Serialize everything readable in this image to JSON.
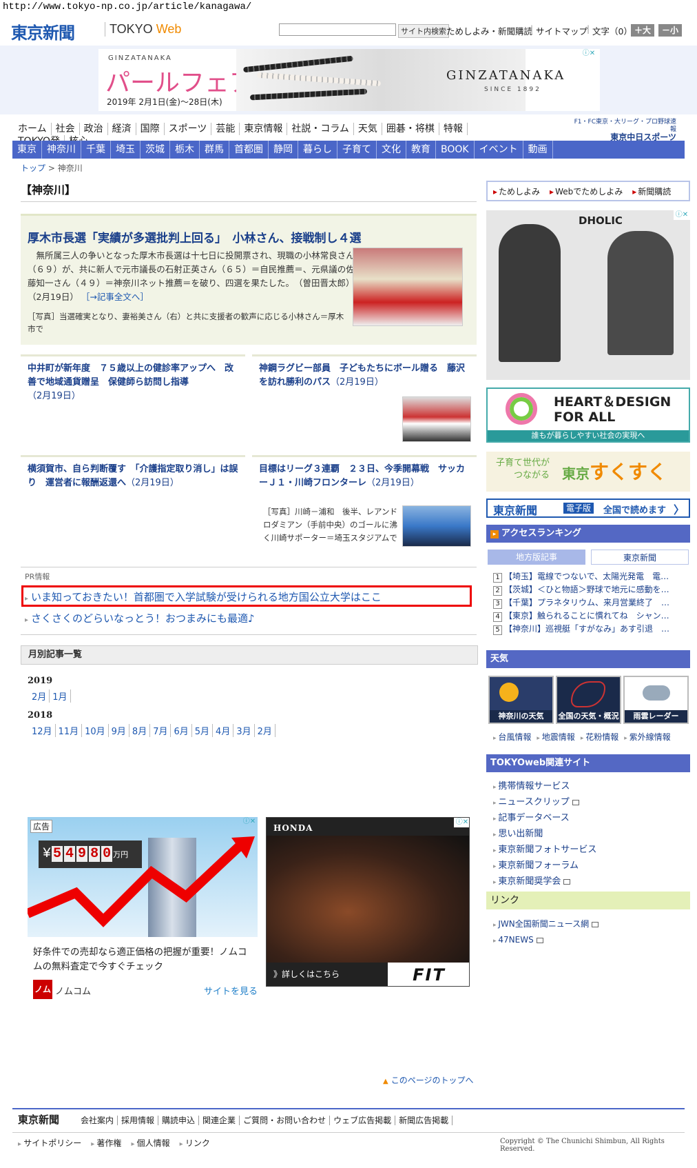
{
  "url": "http://www.tokyo-np.co.jp/article/kanagawa/",
  "header": {
    "logo": "東京新聞",
    "logo_web_prefix": "TOKYO",
    "logo_web_suffix": "Web",
    "search_button": "サイト内検索",
    "links": [
      "ためしよみ・新聞購読",
      "サイトマップ"
    ],
    "text_size_label": "文字（0）",
    "size_up": "＋大",
    "size_down": "－小"
  },
  "banner": {
    "brand": "GINZATANAKA",
    "title": "パールフェア",
    "date": "2019年 2月1日(金)〜28日(木)",
    "logo": "GINZATANAKA",
    "since": "SINCE 1892"
  },
  "nav_main": [
    "ホーム",
    "社会",
    "政治",
    "経済",
    "国際",
    "スポーツ",
    "芸能",
    "東京情報",
    "社説・コラム",
    "天気",
    "囲碁・将棋",
    "特報",
    "TOKYO発",
    "核心"
  ],
  "nav_chunichi": {
    "line1": "F1・FC東京・大リーグ・プロ野球速報",
    "line2": "東京中日スポーツ"
  },
  "nav_region": [
    "東京",
    "神奈川",
    "千葉",
    "埼玉",
    "茨城",
    "栃木",
    "群馬",
    "首都圏",
    "静岡",
    "暮らし",
    "子育て",
    "文化",
    "教育",
    "BOOK",
    "イベント",
    "動画"
  ],
  "breadcrumb": {
    "top": "トップ",
    "sep": ">",
    "current": "神奈川"
  },
  "page_title": "【神奈川】",
  "lead": {
    "headline": "厚木市長選「実績が多選批判上回る」　小林さん、接戦制し４選",
    "body": "　無所属三人の争いとなった厚木市長選は十七日に投開票され、現職の小林常良さん（６９）が、共に新人で元市議長の石射正英さん（６５）＝自民推薦＝、元県議の佐藤知一さん（４９）＝神奈川ネット推薦＝を破り、四選を果たした。　（曽田晋太郎）（2月19日）",
    "more": "［→記事全文へ］",
    "caption": "［写真］当選確実となり、妻裕美さん（右）と共に支援者の歓声に応じる小林さん＝厚木市で"
  },
  "subs": [
    {
      "title": "中井町が新年度　７５歳以上の健診率アップへ　改善で地域通貨贈呈　保健師ら訪問し指導",
      "date": "（2月19日）"
    },
    {
      "title": "神鋼ラグビー部員　子どもたちにボール贈る　藤沢を訪れ勝利のパス",
      "date": "（2月19日）"
    },
    {
      "title": "横須賀市、自ら判断覆す　「介護指定取り消し」は誤り　運営者に報酬返還へ",
      "date": "（2月19日）"
    },
    {
      "title": "目標はリーグ３連覇　２３日、今季開幕戦　サッカーＪ１・川崎フロンターレ",
      "date": "（2月19日）",
      "caption": "［写真］川崎－浦和　後半、レアンドロダミアン（手前中央）のゴールに沸く川崎サポーター＝埼玉スタジアムで"
    }
  ],
  "pr": {
    "label": "PR情報",
    "links": [
      "いま知っておきたい！首都圏で入学試験が受けられる地方国公立大学はここ",
      "さくさくのどらいなっとう！おつまみにも最適♪"
    ]
  },
  "monthly": {
    "heading": "月別記事一覧",
    "years": [
      {
        "year": "2019",
        "months": [
          "2月",
          "1月"
        ]
      },
      {
        "year": "2018",
        "months": [
          "12月",
          "11月",
          "10月",
          "9月",
          "8月",
          "7月",
          "6月",
          "5月",
          "4月",
          "3月",
          "2月"
        ]
      }
    ]
  },
  "ad_nomucom": {
    "label": "広告",
    "yen": "¥",
    "price_digits": [
      "5",
      "4",
      "9",
      "8",
      "0"
    ],
    "unit": "万円",
    "text": "好条件での売却なら適正価格の把握が重要！ノムコムの無料査定で今すぐチェック",
    "logo": "ノム",
    "name": "ノムコム",
    "visit": "サイトを見る"
  },
  "ad_honda": {
    "brand": "HONDA",
    "detail": "》詳しくはこちら",
    "model": "FIT"
  },
  "page_top": "このページのトップへ",
  "footer": {
    "logo": "東京新聞",
    "links": [
      "会社案内",
      "採用情報",
      "購読申込",
      "関連企業",
      "ご質問・お問い合わせ",
      "ウェブ広告掲載",
      "新聞広告掲載"
    ],
    "links2": [
      "サイトポリシー",
      "著作権",
      "個人情報",
      "リンク"
    ],
    "copyright": "Copyright © The Chunichi Shimbun, All Rights Reserved."
  },
  "right": {
    "buttons": [
      "ためしよみ",
      "Webでためしよみ",
      "新聞購読"
    ],
    "ad_brand": "DHOLIC",
    "heart_design": {
      "line1": "HEART＆DESIGN",
      "line2": "FOR ALL",
      "sub": "誰もが暮らしやすい社会の実現へ"
    },
    "sukusuku": {
      "line1": "子育て世代が",
      "line2": "つながる",
      "big_a": "東京",
      "big_b": "すくすく"
    },
    "denshi": {
      "logo": "東京新聞",
      "badge": "電子版",
      "text": "全国で読めます"
    },
    "ranking": {
      "title": "アクセスランキング",
      "tabs": [
        "地方版記事",
        "東京新聞"
      ],
      "items": [
        {
          "n": "1",
          "t": "【埼玉】電線でつないで、太陽光発電　電…"
        },
        {
          "n": "2",
          "t": "【茨城】＜ひと物語＞野球で地元に感動を…"
        },
        {
          "n": "3",
          "t": "【千葉】プラネタリウム、来月営業終了　…"
        },
        {
          "n": "4",
          "t": "【東京】触られることに慣れてね　シャン…"
        },
        {
          "n": "5",
          "t": "【神奈川】巡視艇「すがなみ」あす引退　…"
        }
      ]
    },
    "weather": {
      "title": "天気",
      "tiles": [
        "神奈川の天気",
        "全国の天気・概況",
        "雨雲レーダー"
      ],
      "links": [
        "台風情報",
        "地震情報",
        "花粉情報",
        "紫外線情報"
      ]
    },
    "related": {
      "title": "TOKYOweb関連サイト",
      "items": [
        "携帯情報サービス",
        "ニュースクリップ",
        "記事データベース",
        "思い出新聞",
        "東京新聞フォトサービス",
        "東京新聞フォーラム",
        "東京新聞奨学会"
      ]
    },
    "links": {
      "title": "リンク",
      "items": [
        "JWN全国新聞ニュース網",
        "47NEWS"
      ]
    }
  },
  "colors": {
    "brand_blue": "#1e58b0",
    "nav_blue": "#4a66c8",
    "highlight_red": "#e00000"
  }
}
